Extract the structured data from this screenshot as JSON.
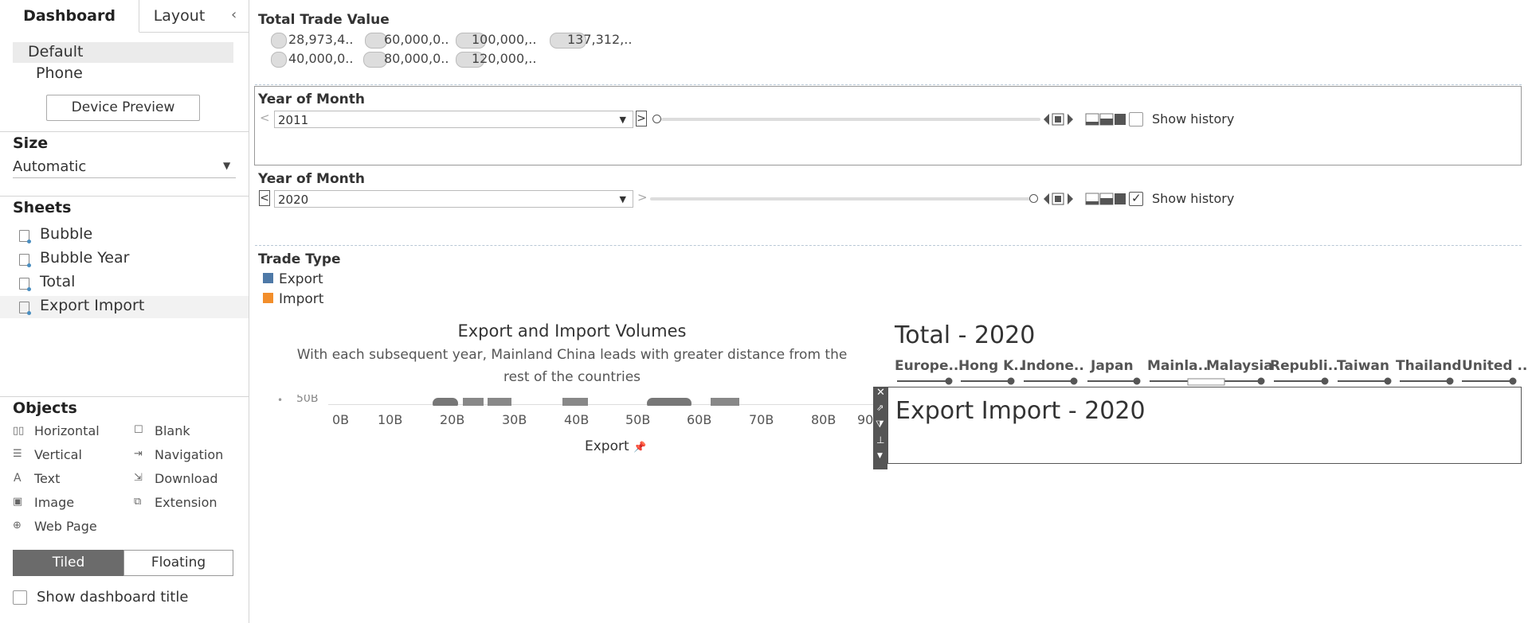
{
  "left_panel": {
    "tabs": {
      "dashboard": "Dashboard",
      "layout": "Layout"
    },
    "collapse_icon": "‹",
    "device": {
      "default": "Default",
      "phone": "Phone",
      "preview_button": "Device Preview"
    },
    "size": {
      "title": "Size",
      "value": "Automatic"
    },
    "sheets": {
      "title": "Sheets",
      "items": [
        {
          "label": "Bubble"
        },
        {
          "label": "Bubble Year"
        },
        {
          "label": "Total"
        },
        {
          "label": "Export Import"
        }
      ]
    },
    "objects": {
      "title": "Objects",
      "items": [
        {
          "label": "Horizontal",
          "icon": "horizontal-container-icon"
        },
        {
          "label": "Blank",
          "icon": "blank-icon"
        },
        {
          "label": "Vertical",
          "icon": "vertical-container-icon"
        },
        {
          "label": "Navigation",
          "icon": "navigation-icon"
        },
        {
          "label": "Text",
          "icon": "text-icon"
        },
        {
          "label": "Download",
          "icon": "download-icon"
        },
        {
          "label": "Image",
          "icon": "image-icon"
        },
        {
          "label": "Extension",
          "icon": "extension-icon"
        },
        {
          "label": "Web Page",
          "icon": "globe-icon"
        }
      ]
    },
    "layout_mode": {
      "tiled": "Tiled",
      "floating": "Floating"
    },
    "show_title": "Show dashboard title"
  },
  "size_legend": {
    "title": "Total Trade Value",
    "row1": [
      "28,973,4..",
      "60,000,0..",
      "100,000,..",
      "137,312,.."
    ],
    "row2": [
      "40,000,0..",
      "80,000,0..",
      "120,000,.."
    ]
  },
  "filter1": {
    "title": "Year of Month",
    "value": "2011",
    "show_history": "Show history",
    "checked": false
  },
  "filter2": {
    "title": "Year of Month",
    "value": "2020",
    "show_history": "Show history",
    "checked": true
  },
  "trade_legend": {
    "title": "Trade Type",
    "items": [
      {
        "label": "Export",
        "color": "#4e79a7"
      },
      {
        "label": "Import",
        "color": "#f28e2b"
      }
    ]
  },
  "chart": {
    "title": "Export and Import Volumes",
    "subtitle_line1": "With each subsequent year, Mainland China leads with greater distance from the",
    "subtitle_line2": "rest of the countries",
    "y_tick": "50B",
    "x_ticks": [
      "0B",
      "10B",
      "20B",
      "30B",
      "40B",
      "50B",
      "60B",
      "70B",
      "80B",
      "90"
    ],
    "xlabel": "Export"
  },
  "total_sheet": {
    "title": "Total - 2020",
    "countries": [
      "Europe..",
      "Hong K..",
      "Indone..",
      "Japan",
      "Mainla..",
      "Malaysia",
      "Republi..",
      "Taiwan",
      "Thailand",
      "United .."
    ]
  },
  "export_import_sheet": {
    "title": "Export Import - 2020"
  }
}
